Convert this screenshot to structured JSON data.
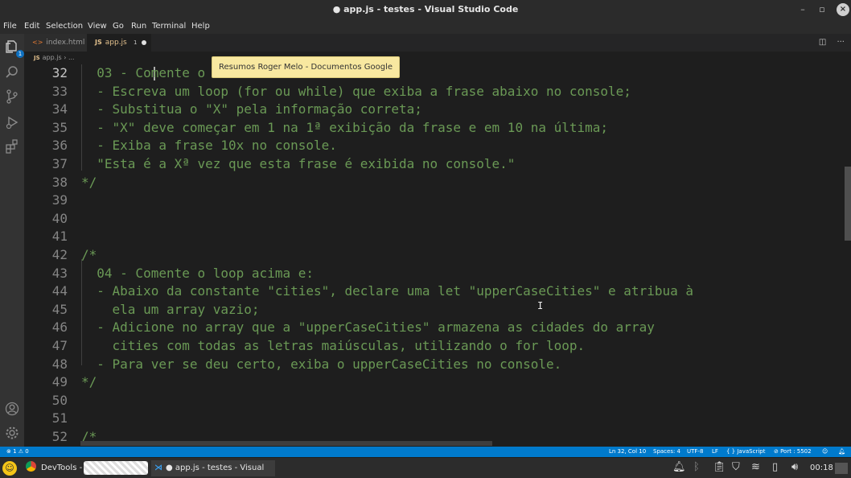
{
  "window": {
    "title": "● app.js - testes - Visual Studio Code"
  },
  "menu": [
    "File",
    "Edit",
    "Selection",
    "View",
    "Go",
    "Run",
    "Terminal",
    "Help"
  ],
  "activity": {
    "explorer_badge": "1"
  },
  "tabs": [
    {
      "icon": "<>",
      "label": "index.html",
      "modified": ""
    },
    {
      "icon": "JS",
      "label": "app.js",
      "modified": "1"
    }
  ],
  "breadcrumb": {
    "icon": "JS",
    "file": "app.js",
    "rest": "› ..."
  },
  "tooltip": "Resumos Roger Melo - Documentos Google",
  "editor": {
    "cursor_line": "32",
    "lines": [
      {
        "n": "32",
        "t": "  03 - Comente o "
      },
      {
        "n": "33",
        "t": "  - Escreva um loop (for ou while) que exiba a frase abaixo no console;"
      },
      {
        "n": "34",
        "t": "  - Substitua o \"X\" pela informação correta;"
      },
      {
        "n": "35",
        "t": "  - \"X\" deve começar em 1 na 1ª exibição da frase e em 10 na última;"
      },
      {
        "n": "36",
        "t": "  - Exiba a frase 10x no console."
      },
      {
        "n": "37",
        "t": "  \"Esta é a Xª vez que esta frase é exibida no console.\""
      },
      {
        "n": "38",
        "t": "*/"
      },
      {
        "n": "39",
        "t": ""
      },
      {
        "n": "40",
        "t": ""
      },
      {
        "n": "41",
        "t": ""
      },
      {
        "n": "42",
        "t": "/*"
      },
      {
        "n": "43",
        "t": "  04 - Comente o loop acima e:"
      },
      {
        "n": "44",
        "t": "  - Abaixo da constante \"cities\", declare uma let \"upperCaseCities\" e atribua à"
      },
      {
        "n": "45",
        "t": "    ela um array vazio;"
      },
      {
        "n": "46",
        "t": "  - Adicione no array que a \"upperCaseCities\" armazena as cidades do array"
      },
      {
        "n": "47",
        "t": "    cities com todas as letras maiúsculas, utilizando o for loop."
      },
      {
        "n": "48",
        "t": "  - Para ver se deu certo, exiba o upperCaseCities no console."
      },
      {
        "n": "49",
        "t": "*/"
      },
      {
        "n": "50",
        "t": ""
      },
      {
        "n": "51",
        "t": ""
      },
      {
        "n": "52",
        "t": "/*"
      }
    ]
  },
  "status": {
    "errors": "⊗ 1 ⚠ 0",
    "position": "Ln 32, Col 10",
    "spaces": "Spaces: 4",
    "encoding": "UTF-8",
    "eol": "LF",
    "language": "{ } JavaScript",
    "port": "⊘ Port : 5502"
  },
  "taskbar": {
    "devtools": "DevTools -",
    "vscode": "● app.js - testes - Visual St...",
    "clock": "00:18"
  },
  "colors": {
    "comment": "#6a9955",
    "statusbar": "#007acc",
    "tooltip_bg": "#f8e8a0"
  }
}
